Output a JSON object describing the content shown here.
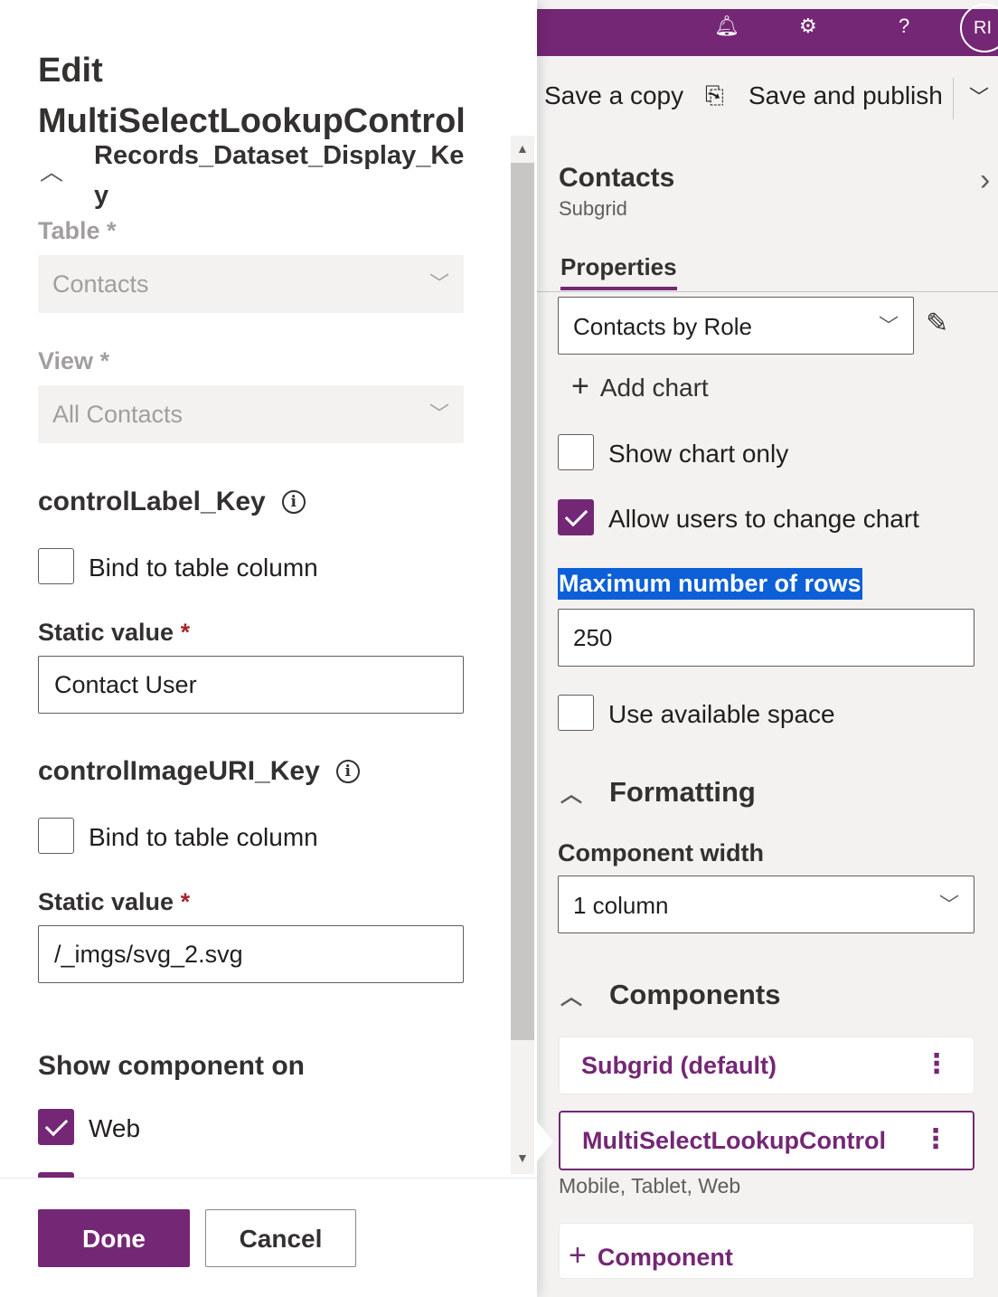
{
  "topbar": {
    "icons": [
      "bell-icon",
      "gear-icon",
      "help-icon"
    ],
    "avatar_initials": "RI",
    "help_glyph": "?"
  },
  "command_bar": {
    "save_copy": "Save a copy",
    "save_publish": "Save and publish"
  },
  "properties_panel": {
    "title": "Contacts",
    "subtitle": "Subgrid",
    "tab": "Properties",
    "chart_select": "Contacts by Role",
    "add_chart": "Add chart",
    "show_chart_only": {
      "label": "Show chart only",
      "checked": false
    },
    "allow_change_chart": {
      "label": "Allow users to change chart",
      "checked": true
    },
    "max_rows_label": "Maximum number of rows",
    "max_rows_value": "250",
    "use_space": {
      "label": "Use available space",
      "checked": false
    },
    "formatting_header": "Formatting",
    "component_width_label": "Component width",
    "component_width_value": "1 column",
    "components_header": "Components",
    "components": [
      {
        "label": "Subgrid (default)"
      },
      {
        "label": "MultiSelectLookupControl",
        "meta": "Mobile, Tablet, Web"
      }
    ],
    "add_component": "Component"
  },
  "dialog": {
    "title": "Edit MultiSelectLookupControl",
    "section_key": "Records_Dataset_Display_Key",
    "table_label": "Table",
    "table_value": "Contacts",
    "view_label": "View",
    "view_value": "All Contacts",
    "control_label_key": "controlLabel_Key",
    "bind_label_1": "Bind to table column",
    "static_value_label_1": "Static value",
    "static_value_1": "Contact User",
    "control_image_key": "controlImageURI_Key",
    "bind_label_2": "Bind to table column",
    "static_value_label_2": "Static value",
    "static_value_2": "/_imgs/svg_2.svg",
    "show_component_on": "Show component on",
    "web_label": "Web",
    "required_mark": "*",
    "info_glyph": "i",
    "done": "Done",
    "cancel": "Cancel"
  },
  "colors": {
    "accent": "#742774",
    "highlight": "#0c5fd6",
    "required": "#a4262c"
  }
}
